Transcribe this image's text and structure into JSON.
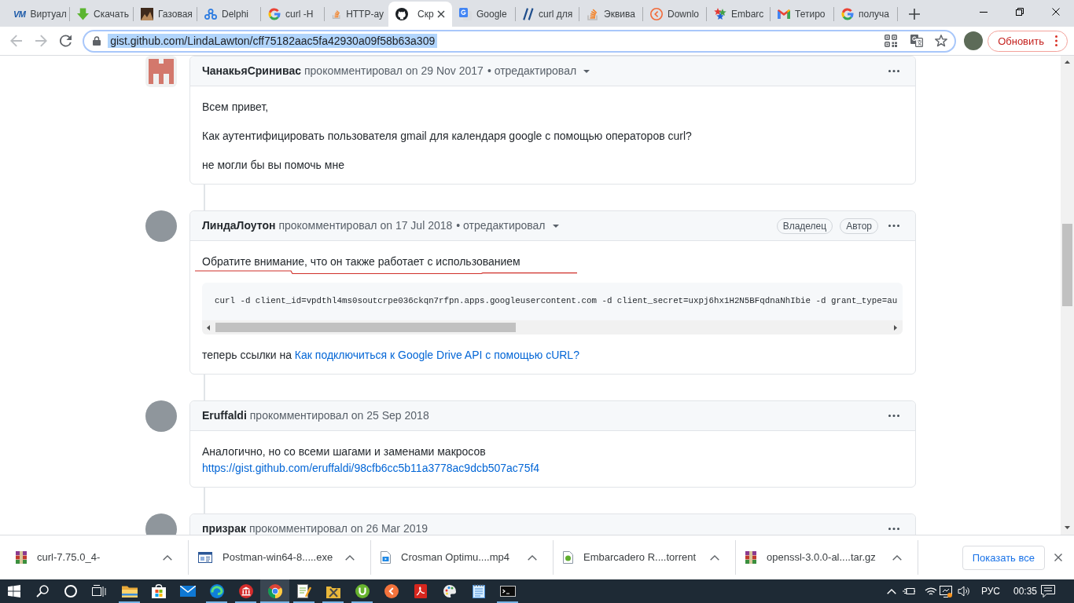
{
  "browser": {
    "tabs": [
      {
        "kind": "vm",
        "logo": "VM",
        "title": "Виртуал",
        "selected": false
      },
      {
        "kind": "arrow",
        "title": "Скачать",
        "selected": false
      },
      {
        "kind": "picture",
        "title": "Газовая",
        "selected": false
      },
      {
        "kind": "circles",
        "title": "Delphi",
        "selected": false
      },
      {
        "kind": "gletter",
        "title": "curl -H",
        "selected": false
      },
      {
        "kind": "stack",
        "title": "HTTP-ау",
        "selected": false
      },
      {
        "kind": "octocat",
        "title": "Скр",
        "selected": true
      },
      {
        "kind": "translate",
        "title": "Google",
        "selected": false
      },
      {
        "kind": "slashes",
        "title": "curl для",
        "selected": false
      },
      {
        "kind": "stack",
        "title": "Эквива",
        "selected": false
      },
      {
        "kind": "chevron",
        "title": "Downlo",
        "selected": false
      },
      {
        "kind": "stars",
        "title": "Embarc",
        "selected": false
      },
      {
        "kind": "mail",
        "title": "Тетиро",
        "selected": false
      },
      {
        "kind": "gletter",
        "title": "получа",
        "selected": false
      }
    ],
    "toolbar": {
      "back": {
        "disabled": true
      },
      "forward": {
        "disabled": true
      },
      "address": "gist.github.com/LindaLawton/cff75182aac5fa42930a09f58b63a309",
      "address_selected": true,
      "update_button": "Обновить"
    }
  },
  "comments": [
    {
      "avatar": {
        "kind": "identicon"
      },
      "author": "ЧанакьяСринивас",
      "action": "прокомментировал",
      "date": "on 29 Nov 2017",
      "edited": "• отредактировал",
      "body": [
        {
          "kind": "paragraph",
          "text": "Всем привет,",
          "underlined": false
        },
        {
          "kind": "paragraph",
          "text": "Как аутентифицировать пользователя gmail для календаря google с помощью операторов curl?",
          "underlined": false
        },
        {
          "kind": "paragraph",
          "text": "не могли бы вы помочь мне",
          "underlined": false
        }
      ]
    },
    {
      "avatar": {
        "kind": "photo"
      },
      "author": "ЛиндаЛоутон",
      "action": "прокомментировал",
      "date": "on 17 Jul 2018",
      "edited": "• отредактировал",
      "badges": [
        "Владелец",
        "Автор"
      ],
      "body": [
        {
          "kind": "paragraph",
          "text": "Обратите внимание, что он также работает с использованием",
          "underlined": true
        },
        {
          "kind": "code",
          "text": "curl -d client_id=vpdthl4ms0soutcrpe036ckqn7rfpn.apps.googleusercontent.com -d client_secret=uxpj6hx1H2N5BFqdnaNhIbie -d grant_type=au"
        },
        {
          "kind": "paragraph",
          "text": "теперь ссылки на",
          "link": "Как подключиться к Google Drive API с помощью cURL?",
          "link_on_new_line": false,
          "underlined": false
        }
      ]
    },
    {
      "avatar": {
        "kind": "photo"
      },
      "author": "Eruffaldi",
      "action": "прокомментировал",
      "date": "on 25 Sep 2018",
      "body": [
        {
          "kind": "paragraph",
          "text": "Аналогично, но со всеми шагами и заменами макросов",
          "link": "https://gist.github.com/eruffaldi/98cfb6cc5b11a3778ac9dcb507ac75f4",
          "link_on_new_line": true,
          "underlined": false
        }
      ]
    },
    {
      "avatar": {
        "kind": "photo"
      },
      "author": "призрак",
      "action": "прокомментировал",
      "date": "on 26 Mar 2019"
    }
  ],
  "downloads": {
    "items": [
      {
        "kind": "archive",
        "name": "curl-7.75.0_4-"
      },
      {
        "kind": "program",
        "name": "Postman-win64-8.....exe"
      },
      {
        "kind": "video",
        "name": "Crosman Optimu....mp4"
      },
      {
        "kind": "torrent",
        "name": "Embarcadero R....torrent"
      },
      {
        "kind": "archive",
        "name": "openssl-3.0.0-al....tar.gz"
      }
    ],
    "show_all": "Показать все"
  },
  "taskbar": {
    "apps": [
      {
        "kind": "folder",
        "running": true,
        "selected": false
      },
      {
        "kind": "bag",
        "running": false,
        "selected": false
      },
      {
        "kind": "mail",
        "running": false,
        "selected": false
      },
      {
        "kind": "swirl",
        "running": true,
        "selected": false
      },
      {
        "kind": "bank",
        "running": true,
        "selected": false
      },
      {
        "kind": "browser",
        "running": true,
        "selected": true
      },
      {
        "kind": "notepadpen",
        "running": true,
        "selected": false
      },
      {
        "kind": "tools",
        "running": true,
        "selected": false
      },
      {
        "kind": "ucircle",
        "running": true,
        "selected": false
      },
      {
        "kind": "chevron",
        "running": false,
        "selected": false
      },
      {
        "kind": "pdf",
        "running": false,
        "selected": false
      },
      {
        "kind": "palette",
        "running": false,
        "selected": false
      },
      {
        "kind": "notepad",
        "running": false,
        "selected": false
      },
      {
        "kind": "terminal",
        "running": true,
        "selected": false
      }
    ],
    "language": "РУС",
    "clock": "00:35"
  }
}
